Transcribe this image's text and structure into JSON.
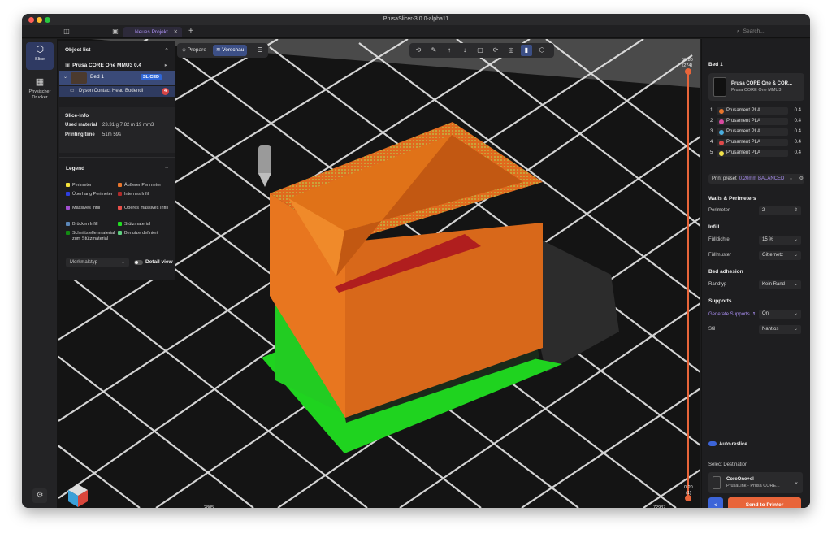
{
  "window": {
    "title": "PrusaSlicer-3.0.0-alpha11"
  },
  "tabs": {
    "project_tab": "Neues Projekt",
    "close": "✕",
    "add": "+"
  },
  "search": {
    "placeholder": "Search..."
  },
  "rail": {
    "slice_label": "Slice",
    "physical_printer_label": "Physischer Drucker"
  },
  "viewport_toolbar": {
    "prepare_label": "Prepare",
    "preview_label": "Vorschau"
  },
  "object_list": {
    "title": "Object list",
    "printer": "Prusa CORE One MMU3 0.4",
    "bed_label": "Bed 1",
    "sliced_badge": "SLICED",
    "object_name": "Dyson Contact Head Bodendi",
    "warning_count": "4"
  },
  "slice_info": {
    "title": "Slice-Info",
    "used_material_label": "Used material",
    "used_material_value": "23.31 g  7.82 m  19 mm3",
    "printing_time_label": "Printing time",
    "printing_time_value": "51m 59s"
  },
  "legend": {
    "title": "Legend",
    "items": [
      {
        "label": "Perimeter",
        "color": "#f5e23b"
      },
      {
        "label": "Äußerer Perimeter",
        "color": "#e8762c"
      },
      {
        "label": "Überhang Perimeter",
        "color": "#2d3ee0"
      },
      {
        "label": "Internes Infill",
        "color": "#b02a2a"
      },
      {
        "label": "Massives Infill",
        "color": "#a24fd1"
      },
      {
        "label": "Oberes massives Infill",
        "color": "#e8504a"
      },
      {
        "label": "Brücken Infill",
        "color": "#5b87b8"
      },
      {
        "label": "Stützmaterial",
        "color": "#22dd22"
      },
      {
        "label": "Schnittstellenmaterial zum Stützmaterial",
        "color": "#138a13"
      },
      {
        "label": "Benutzerdefiniert",
        "color": "#5fcf80"
      }
    ],
    "feature_select": "Merkmalstyp",
    "detail_view": "Detail view"
  },
  "sliders": {
    "vertical_top": "50.80",
    "vertical_top_layer": "(274)",
    "vertical_bottom": "0.20",
    "vertical_bottom_layer": "(1)",
    "horizontal_left": "2805",
    "horizontal_right": "72937"
  },
  "right_panel": {
    "bed_title": "Bed 1",
    "printer_name": "Prusa CORE One & COR...",
    "printer_model": "Prusa CORE One MMU3",
    "filaments": [
      {
        "num": "1",
        "name": "Prusament PLA",
        "nozzle": "0.4",
        "color": "#e8762c"
      },
      {
        "num": "2",
        "name": "Prusament PLA",
        "nozzle": "0.4",
        "color": "#d94aa0"
      },
      {
        "num": "3",
        "name": "Prusament PLA",
        "nozzle": "0.4",
        "color": "#4aaee0"
      },
      {
        "num": "4",
        "name": "Prusament PLA",
        "nozzle": "0.4",
        "color": "#e04a4a"
      },
      {
        "num": "5",
        "name": "Prusament PLA",
        "nozzle": "0.4",
        "color": "#f2e24a"
      }
    ],
    "print_preset_label": "Print preset",
    "print_preset_value": "0.20mm BALANCED",
    "walls_title": "Walls & Perimeters",
    "perimeter_label": "Perimeter",
    "perimeter_value": "2",
    "infill_title": "Infill",
    "fill_density_label": "Fülldichte",
    "fill_density_value": "15 %",
    "fill_pattern_label": "Füllmuster",
    "fill_pattern_value": "Gitternetz",
    "bed_adhesion_title": "Bed adhesion",
    "brim_label": "Randtyp",
    "brim_value": "Kein Rand",
    "supports_title": "Supports",
    "generate_supports_label": "Generate Supports",
    "generate_supports_value": "On",
    "style_label": "Stil",
    "style_value": "Nahtlos",
    "auto_reslice": "Auto-reslice",
    "select_destination": "Select Destination",
    "destination_name": "CoreOne+el",
    "destination_detail": "PrusaLink - Prusa CORE...",
    "back_label": "<",
    "send_label": "Send to Printer"
  }
}
